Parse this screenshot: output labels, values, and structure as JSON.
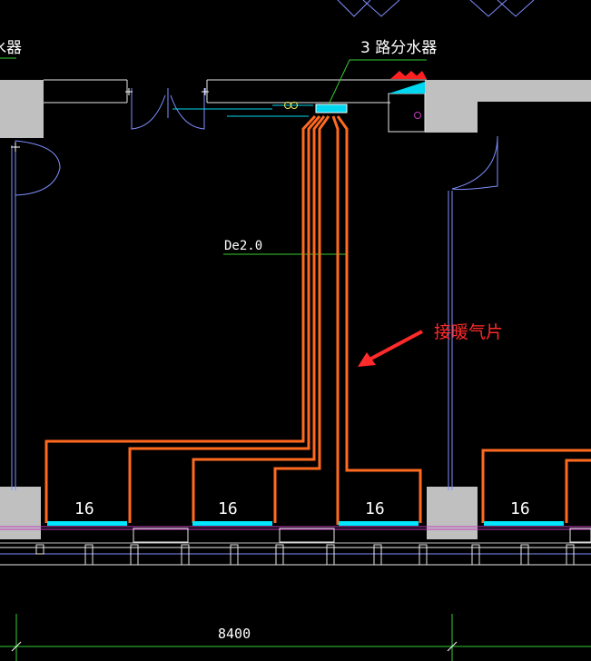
{
  "drawing": {
    "manifold_label": "3 路分水器",
    "left_cut_label": "水器",
    "pipe_label": "De2.0",
    "note": "接暖气片",
    "radiators": [
      {
        "value": "16"
      },
      {
        "value": "16"
      },
      {
        "value": "16"
      },
      {
        "value": "16"
      }
    ],
    "dimension": "8400"
  },
  "colors": {
    "background": "#000000",
    "wall_fill": "#c0c0c0",
    "pipe": "#ff6a1f",
    "door_lines": "#7f8fff",
    "leader": "#33cc33",
    "annotation": "#ff2a2a",
    "manifold": "#00d7f0",
    "radiator": "#00e6ff",
    "window_line": "#c040c0"
  }
}
